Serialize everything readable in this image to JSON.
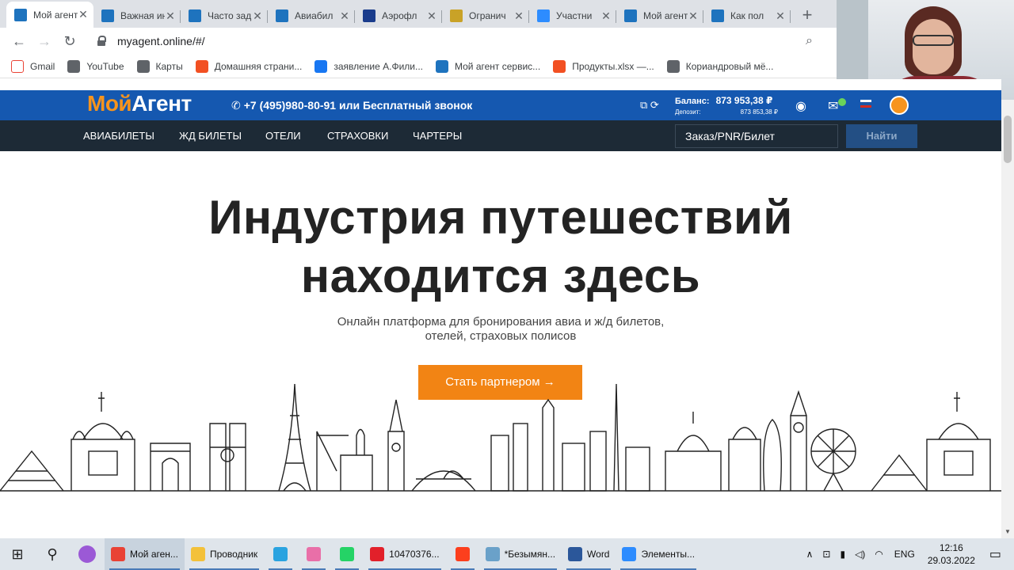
{
  "browser": {
    "tabs": [
      {
        "title": "Мой агент",
        "color": "#1e73be",
        "active": true
      },
      {
        "title": "Важная ин",
        "color": "#1e73be"
      },
      {
        "title": "Часто зад",
        "color": "#1e73be"
      },
      {
        "title": "Авиабил",
        "color": "#1e73be"
      },
      {
        "title": "Аэрофл",
        "color": "#1a3c8c"
      },
      {
        "title": "Огранич",
        "color": "#c9a227"
      },
      {
        "title": "Участни",
        "color": "#2d8cff"
      },
      {
        "title": "Мой агент",
        "color": "#1e73be"
      },
      {
        "title": "Как пол",
        "color": "#1e73be"
      }
    ],
    "url": "myagent.online/#/",
    "bookmarks": [
      {
        "label": "Gmail",
        "color": "#ffffff"
      },
      {
        "label": "YouTube",
        "color": "#5f6368"
      },
      {
        "label": "Карты",
        "color": "#5f6368"
      },
      {
        "label": "Домашняя страни...",
        "color": "#f25022"
      },
      {
        "label": "заявление А.Фили...",
        "color": "#1877f2"
      },
      {
        "label": "Мой агент сервис...",
        "color": "#1e73be"
      },
      {
        "label": "Продукты.xlsx —...",
        "color": "#f25022"
      },
      {
        "label": "Кориандровый мё...",
        "color": "#5f6368"
      }
    ]
  },
  "site": {
    "logo_part1": "Мой",
    "logo_part2": "Агент",
    "phone": "+7 (495)980-80-91  или Бесплатный звонок",
    "balance_label": "Баланс:",
    "balance_value": "873 953,38 ₽",
    "deposit_label": "Депозит:",
    "deposit_value": "873 853,38 ₽",
    "nav": [
      "АВИАБИЛЕТЫ",
      "ЖД БИЛЕТЫ",
      "ОТЕЛИ",
      "СТРАХОВКИ",
      "ЧАРТЕРЫ"
    ],
    "search_placeholder": "Заказ/PNR/Билет",
    "search_button": "Найти",
    "hero_line1": "Индустрия путешествий",
    "hero_line2": "находится здесь",
    "hero_sub1": "Онлайн платформа для бронирования авиа и ж/д билетов,",
    "hero_sub2": "отелей, страховых полисов",
    "cta": "Стать партнером →",
    "colors": {
      "header_blue": "#1558b0",
      "nav_dark": "#1d2a36",
      "orange": "#f28414"
    }
  },
  "taskbar": {
    "apps": [
      {
        "label": "Мой аген...",
        "color": "#e94235",
        "active": true
      },
      {
        "label": "Проводник",
        "color": "#f3c13a"
      },
      {
        "label": "",
        "color": "#2aa3e0"
      },
      {
        "label": "",
        "color": "#e96fa8"
      },
      {
        "label": "",
        "color": "#25d366"
      },
      {
        "label": "10470376...",
        "color": "#e2202a"
      },
      {
        "label": "",
        "color": "#fc3f1d"
      },
      {
        "label": "*Безымян...",
        "color": "#6aa1c9"
      },
      {
        "label": "Word",
        "color": "#2b579a"
      },
      {
        "label": "Элементы...",
        "color": "#2d8cff"
      }
    ],
    "lang": "ENG",
    "time": "12:16",
    "date": "29.03.2022"
  }
}
